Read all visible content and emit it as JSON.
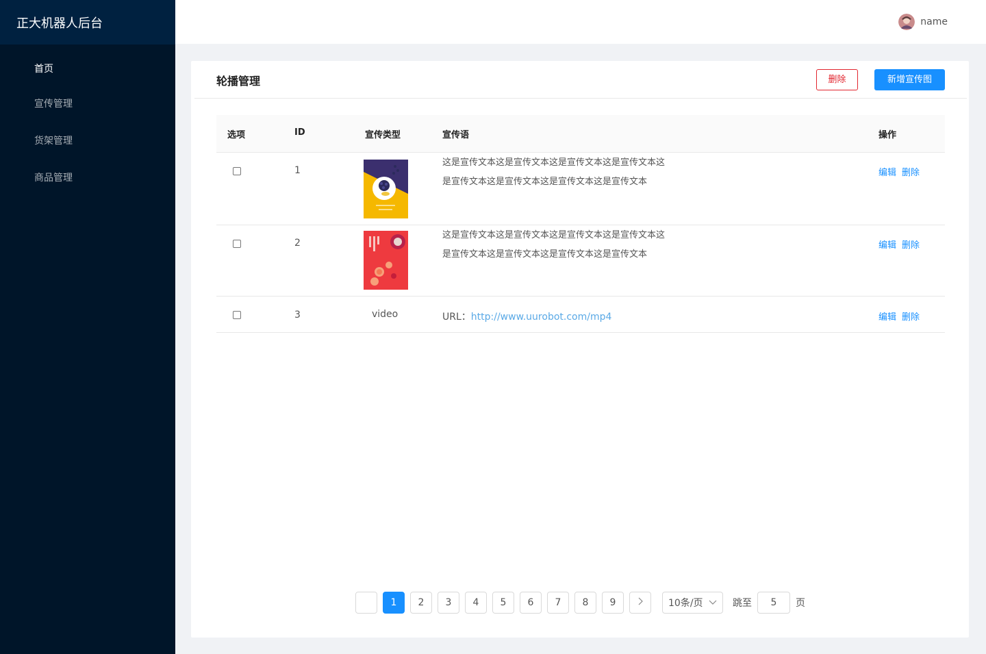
{
  "app": {
    "title": "正大机器人后台"
  },
  "sidebar": {
    "items": [
      {
        "label": "首页"
      },
      {
        "label": "宣传管理"
      },
      {
        "label": "货架管理"
      },
      {
        "label": "商品管理"
      }
    ]
  },
  "header": {
    "username": "name"
  },
  "page": {
    "title": "轮播管理",
    "delete_label": "删除",
    "add_label": "新增宣传图"
  },
  "table": {
    "columns": [
      "选项",
      "ID",
      "宣传类型",
      "宣传语",
      "操作"
    ],
    "rows": [
      {
        "id": "1",
        "type": "image",
        "slogan_line1": "这是宣传文本这是宣传文本这是宣传文本这是宣传文本这",
        "slogan_line2": "是宣传文本这是宣传文本这是宣传文本这是宣传文本",
        "edit": "编辑",
        "delete": "删除"
      },
      {
        "id": "2",
        "type": "image",
        "slogan_line1": "这是宣传文本这是宣传文本这是宣传文本这是宣传文本这",
        "slogan_line2": "是宣传文本这是宣传文本这是宣传文本这是宣传文本",
        "edit": "编辑",
        "delete": "删除"
      },
      {
        "id": "3",
        "type": "video",
        "url_label": "URL：",
        "url": "http://www.uurobot.com/mp4",
        "edit": "编辑",
        "delete": "删除"
      }
    ]
  },
  "pagination": {
    "pages": [
      "1",
      "2",
      "3",
      "4",
      "5",
      "6",
      "7",
      "8",
      "9"
    ],
    "current": "1",
    "page_size": "10条/页",
    "jump_label": "跳至",
    "jump_value": "5",
    "page_unit": "页"
  },
  "colors": {
    "primary": "#1890ff",
    "danger": "#e2252e",
    "sidebar": "#001529"
  }
}
